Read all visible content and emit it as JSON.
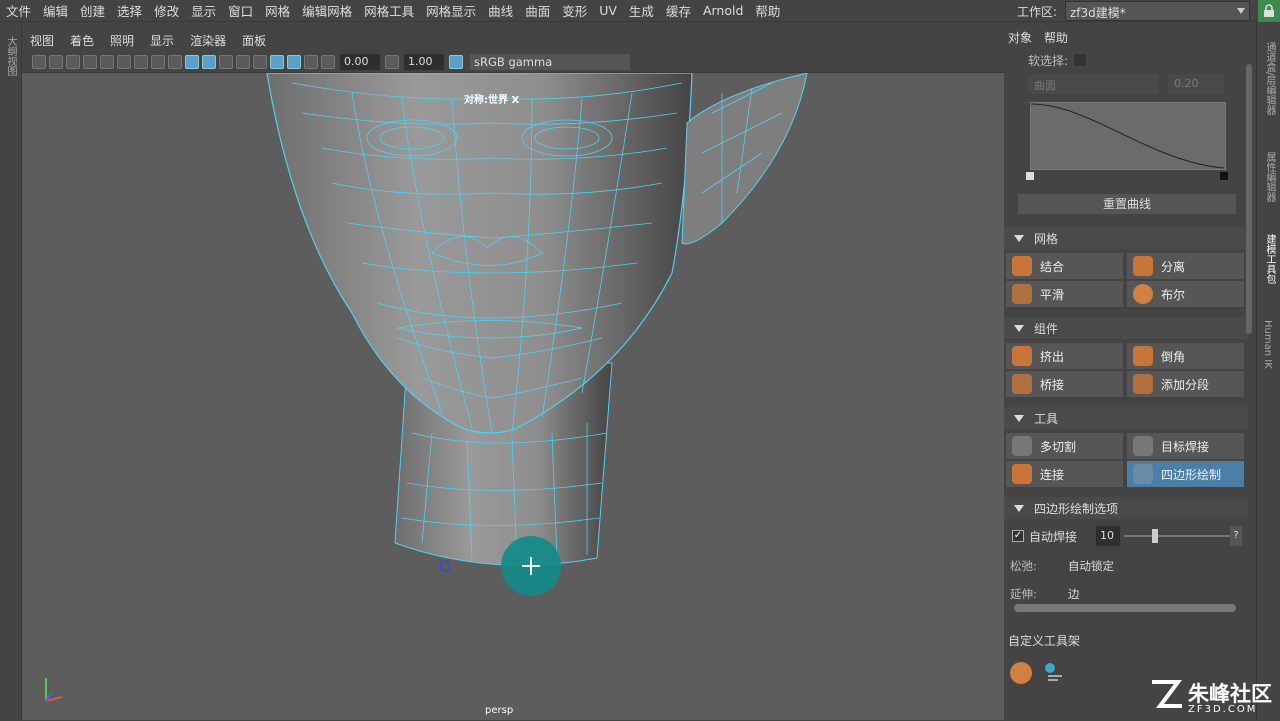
{
  "menubar": {
    "items": [
      "文件",
      "编辑",
      "创建",
      "选择",
      "修改",
      "显示",
      "窗口",
      "网格",
      "编辑网格",
      "网格工具",
      "网格显示",
      "曲线",
      "曲面",
      "变形",
      "UV",
      "生成",
      "缓存",
      "Arnold",
      "帮助"
    ]
  },
  "workspace": {
    "label": "工作区:",
    "value": "zf3d建模*"
  },
  "left_strip_label": "大纲视图",
  "viewport": {
    "menu": [
      "视图",
      "着色",
      "照明",
      "显示",
      "渲染器",
      "面板"
    ],
    "exposure": "0.00",
    "gamma": "1.00",
    "colorspace": "sRGB gamma",
    "symmetry_label": "对称:世界 X",
    "camera": "persp"
  },
  "panel": {
    "menu": [
      "对象",
      "帮助"
    ],
    "soft_select_label": "软选择:",
    "falloff_mode": "曲面",
    "falloff_value": "0.20",
    "reset_curve": "重置曲线",
    "sections": [
      {
        "title": "网格",
        "buttons": [
          "结合",
          "分离",
          "平滑",
          "布尔"
        ]
      },
      {
        "title": "组件",
        "buttons": [
          "挤出",
          "倒角",
          "桥接",
          "添加分段"
        ]
      },
      {
        "title": "工具",
        "buttons": [
          "多切割",
          "目标焊接",
          "连接",
          "四边形绘制"
        ]
      }
    ],
    "options_title": "四边形绘制选项",
    "auto_weld_label": "自动焊接",
    "auto_weld_value": "10",
    "help_btn": "?",
    "relax_label": "松弛:",
    "relax_value": "自动锁定",
    "extend_label": "延伸:",
    "extend_value": "边",
    "shelf_title": "自定义工具架"
  },
  "right_strip": [
    "通道盒/层编辑器",
    "属性编辑器",
    "建模工具包",
    "Human IK"
  ],
  "watermark": {
    "brand": "朱峰社区",
    "site": "ZF3D.COM"
  },
  "colors": {
    "accent": "#4d7fa6",
    "wire": "#52d0f0",
    "viewport_bg": "#5d5d5d",
    "panel_bg": "#444444",
    "cursor": "#128b8b"
  }
}
